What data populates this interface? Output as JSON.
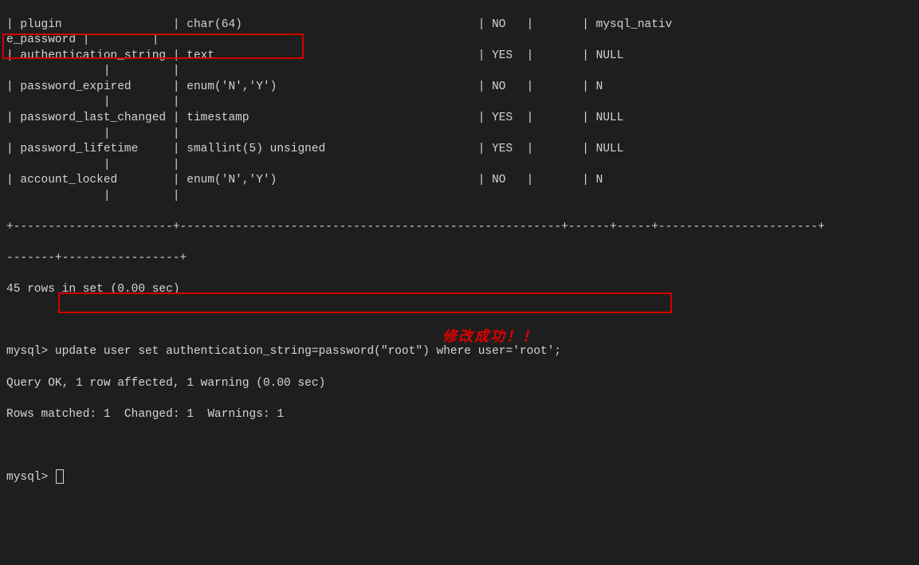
{
  "table": {
    "rows": [
      {
        "field": "plugin",
        "type": "char(64)",
        "null": "NO",
        "default": "mysql_nativ"
      },
      {
        "field_wrap": "e_password"
      },
      {
        "field": "authentication_string",
        "type": "text",
        "null": "YES",
        "default": "NULL"
      },
      {
        "field": "password_expired",
        "type": "enum('N','Y')",
        "null": "NO",
        "default": "N"
      },
      {
        "field": "password_last_changed",
        "type": "timestamp",
        "null": "YES",
        "default": "NULL"
      },
      {
        "field": "password_lifetime",
        "type": "smallint(5) unsigned",
        "null": "YES",
        "default": "NULL"
      },
      {
        "field": "account_locked",
        "type": "enum('N','Y')",
        "null": "NO",
        "default": "N"
      }
    ],
    "blank_sep": "              |         |",
    "footer_sep": "+-----------------------+-------------------------------------------------------+------+-----+-----------------------+",
    "footer_sep2": "-------+-----------------+",
    "summary": "45 rows in set (0.00 sec)"
  },
  "cmd": {
    "prompt": "mysql>",
    "update_stmt": "update user set authentication_string=password(\"root\") where user='root';",
    "result1": "Query OK, 1 row affected, 1 warning (0.00 sec)",
    "result2": "Rows matched: 1  Changed: 1  Warnings: 1"
  },
  "annotation": "修改成功！！"
}
